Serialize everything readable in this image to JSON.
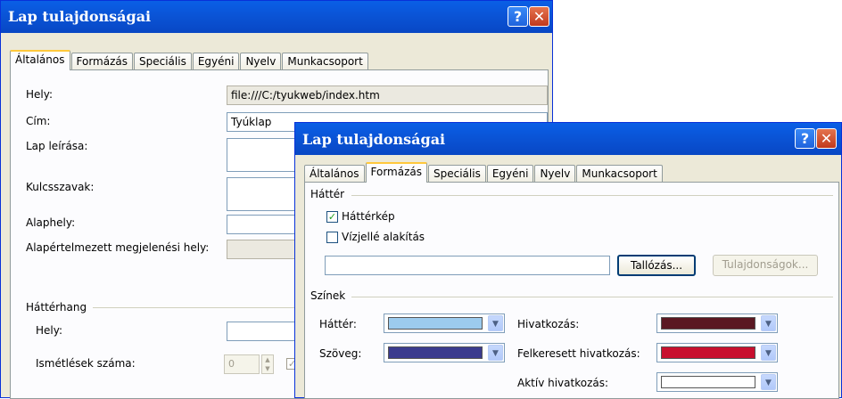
{
  "win1": {
    "title": "Lap tulajdonságai",
    "help": "?",
    "close": "✕",
    "tabs": [
      "Általános",
      "Formázás",
      "Speciális",
      "Egyéni",
      "Nyelv",
      "Munkacsoport"
    ],
    "hely_label": "Hely:",
    "hely_value": "file:///C:/tyukweb/index.htm",
    "cim_label": "Cím:",
    "cim_value": "Tyúklap",
    "leiras_label": "Lap leírása:",
    "kulcs_label": "Kulcsszavak:",
    "alaphely_label": "Alaphely:",
    "alap_megj_label": "Alapértelmezett megjelenési hely:",
    "hatterhang_group": "Háttérhang",
    "hang_hely_label": "Hely:",
    "ismetles_label": "Ismétlések száma:",
    "ismetles_value": "0"
  },
  "win2": {
    "title": "Lap tulajdonságai",
    "help": "?",
    "close": "✕",
    "tabs": [
      "Általános",
      "Formázás",
      "Speciális",
      "Egyéni",
      "Nyelv",
      "Munkacsoport"
    ],
    "hatter_group": "Háttér",
    "hatterkep_label": "Háttérkép",
    "hatterkep_checked": true,
    "vizjel_label": "Vízjellé alakítás",
    "vizjel_checked": false,
    "tallozas": "Tallózás...",
    "tulajdonsagok": "Tulajdonságok...",
    "szinek_group": "Színek",
    "hatter_label": "Háttér:",
    "szoveg_label": "Szöveg:",
    "hivatkozas_label": "Hivatkozás:",
    "felkeresett_label": "Felkeresett hivatkozás:",
    "aktiv_label": "Aktív hivatkozás:",
    "colors": {
      "hatter": "#9ccbee",
      "szoveg": "#3b3b8e",
      "hivatkozas": "#5a1822",
      "felkeresett": "#c8102e",
      "aktiv": "#ffffff"
    }
  }
}
